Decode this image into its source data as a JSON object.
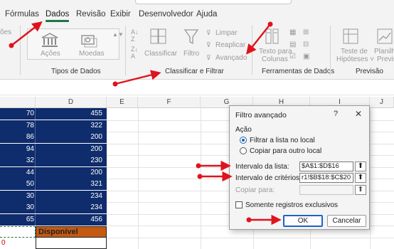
{
  "menu": {
    "tabs": [
      "Fórmulas",
      "Dados",
      "Revisão",
      "Exibir",
      "Desenvolvedor",
      "Ajuda"
    ],
    "active": "Dados"
  },
  "ribbon": {
    "partial_left_label": "ões",
    "tipos_de_dados": {
      "acoes": "Ações",
      "moedas": "Moedas",
      "group_name": "Tipos de Dados"
    },
    "classificar_filtrar": {
      "classificar": "Classificar",
      "filtro": "Filtro",
      "limpar": "Limpar",
      "reaplicar": "Reaplicar",
      "avancado": "Avançado",
      "group_name": "Classificar e Filtrar"
    },
    "ferramentas": {
      "texto_para": "Texto para",
      "colunas": "Colunas",
      "group_name": "Ferramentas de Dados"
    },
    "previsao": {
      "teste_de": "Teste de",
      "hipoteses": "Hipóteses ˅",
      "planilha": "Planilha",
      "previsao_short": "Previs",
      "group_name": "Previsão"
    }
  },
  "grid": {
    "columns": [
      "D",
      "E",
      "F",
      "G",
      "H",
      "I",
      "J"
    ],
    "rows": [
      {
        "c": "70",
        "d": "455"
      },
      {
        "c": "78",
        "d": "322"
      },
      {
        "c": "86",
        "d": "200"
      },
      {
        "c": "94",
        "d": "200"
      },
      {
        "c": "32",
        "d": "230"
      },
      {
        "c": "44",
        "d": "200"
      },
      {
        "c": "50",
        "d": "321"
      },
      {
        "c": "30",
        "d": "234"
      },
      {
        "c": "30",
        "d": "234"
      },
      {
        "c": "65",
        "d": "456"
      }
    ],
    "disponivel": "Disponível",
    "bottom_left_value": "0"
  },
  "dialog": {
    "title": "Filtro avançado",
    "help": "?",
    "close": "✕",
    "acao_label": "Ação",
    "option_in_place": "Filtrar a lista no local",
    "option_copy": "Copiar para outro local",
    "interval_list_label": "Intervalo da lista:",
    "interval_list_value": "$A$1:$D$16",
    "criteria_label": "Intervalo de critérios:",
    "criteria_value": "r1!$B$18:$C$20",
    "copy_to_label": "Copiar para:",
    "copy_to_value": "",
    "unique_label": "Somente registros exclusivos",
    "ok": "OK",
    "cancel": "Cancelar",
    "collapse_glyph": "⬆"
  },
  "colors": {
    "navy": "#0f2c6c",
    "disponivel_bg": "#c55a11",
    "excel_green": "#217346",
    "arrow_red": "#e0131c",
    "primary_border": "#1f62c4"
  }
}
